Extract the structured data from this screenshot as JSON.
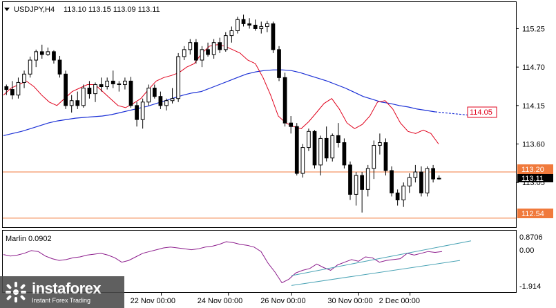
{
  "header": {
    "symbol": "USDJPY,H4",
    "ohlc": "113.10 113.15 113.09 113.11"
  },
  "indicator": {
    "label": "Marlin 0.0902",
    "ticks": [
      "0.8706",
      "0.00",
      "-1.914"
    ]
  },
  "price_labels": {
    "ma_value": "114.05",
    "level_high": "113.20",
    "level_low": "112.54",
    "last": "113.11"
  },
  "watermark": {
    "brand": "instaforex",
    "tagline": "Instant Forex Trading"
  },
  "colors": {
    "candle": "#000000",
    "ma_fast": "#e0001b",
    "ma_slow": "#1a2fd6",
    "level": "#f07a3c",
    "oscillator": "#8b1a8b",
    "channel": "#4aa3b5",
    "badge_border": "#e0001b"
  },
  "chart_data": [
    {
      "type": "candlestick",
      "title": "USDJPY,H4",
      "y_ticks": [
        115.25,
        114.7,
        114.15,
        113.6,
        113.05
      ],
      "x_ticks": [
        "22 Nov 00:00",
        "24 Nov 00:00",
        "26 Nov 00:00",
        "30 Nov 00:00",
        "2 Dec 00:00"
      ],
      "ylim": [
        112.42,
        115.62
      ],
      "levels": [
        113.2,
        112.54
      ],
      "candles": [
        [
          114.42,
          114.45,
          114.3,
          114.38
        ],
        [
          114.38,
          114.5,
          114.24,
          114.3
        ],
        [
          114.3,
          114.55,
          114.25,
          114.48
        ],
        [
          114.48,
          114.65,
          114.4,
          114.6
        ],
        [
          114.6,
          114.85,
          114.55,
          114.8
        ],
        [
          114.8,
          114.95,
          114.7,
          114.92
        ],
        [
          114.92,
          115.02,
          114.82,
          114.88
        ],
        [
          114.88,
          114.98,
          114.86,
          114.92
        ],
        [
          114.92,
          114.94,
          114.75,
          114.8
        ],
        [
          114.8,
          114.86,
          114.55,
          114.6
        ],
        [
          114.6,
          114.65,
          114.1,
          114.15
        ],
        [
          114.15,
          114.3,
          114.05,
          114.22
        ],
        [
          114.22,
          114.35,
          114.1,
          114.15
        ],
        [
          114.15,
          114.45,
          114.12,
          114.4
        ],
        [
          114.4,
          114.5,
          114.25,
          114.32
        ],
        [
          114.32,
          114.48,
          114.2,
          114.45
        ],
        [
          114.45,
          114.55,
          114.35,
          114.42
        ],
        [
          114.42,
          114.55,
          114.38,
          114.5
        ],
        [
          114.5,
          114.65,
          114.4,
          114.46
        ],
        [
          114.46,
          114.5,
          114.35,
          114.45
        ],
        [
          114.45,
          114.55,
          114.38,
          114.5
        ],
        [
          114.5,
          114.56,
          114.12,
          114.15
        ],
        [
          114.15,
          114.2,
          113.85,
          113.95
        ],
        [
          113.95,
          114.25,
          113.82,
          114.2
        ],
        [
          114.2,
          114.45,
          114.15,
          114.4
        ],
        [
          114.4,
          114.45,
          114.25,
          114.28
        ],
        [
          114.28,
          114.35,
          114.1,
          114.15
        ],
        [
          114.15,
          114.25,
          114.08,
          114.22
        ],
        [
          114.22,
          114.4,
          114.18,
          114.25
        ],
        [
          114.25,
          114.9,
          114.2,
          114.85
        ],
        [
          114.85,
          115.0,
          114.8,
          114.95
        ],
        [
          114.95,
          115.1,
          114.88,
          115.05
        ],
        [
          115.05,
          115.1,
          114.75,
          114.8
        ],
        [
          114.8,
          115.0,
          114.7,
          114.95
        ],
        [
          114.95,
          115.05,
          114.85,
          114.88
        ],
        [
          114.88,
          115.1,
          114.82,
          115.05
        ],
        [
          115.05,
          115.12,
          114.9,
          114.95
        ],
        [
          114.95,
          115.2,
          114.92,
          115.15
        ],
        [
          115.15,
          115.28,
          115.05,
          115.22
        ],
        [
          115.22,
          115.42,
          115.18,
          115.38
        ],
        [
          115.38,
          115.45,
          115.28,
          115.32
        ],
        [
          115.32,
          115.4,
          115.25,
          115.3
        ],
        [
          115.3,
          115.38,
          115.22,
          115.25
        ],
        [
          115.25,
          115.35,
          115.18,
          115.28
        ],
        [
          115.28,
          115.36,
          115.2,
          115.32
        ],
        [
          115.32,
          115.35,
          114.9,
          114.95
        ],
        [
          114.95,
          115.0,
          114.5,
          114.55
        ],
        [
          114.55,
          114.62,
          113.85,
          113.9
        ],
        [
          113.9,
          114.0,
          113.75,
          113.85
        ],
        [
          113.85,
          113.9,
          113.15,
          113.18
        ],
        [
          113.18,
          113.6,
          113.12,
          113.55
        ],
        [
          113.55,
          113.82,
          113.5,
          113.78
        ],
        [
          113.78,
          113.8,
          113.25,
          113.3
        ],
        [
          113.3,
          113.72,
          113.15,
          113.68
        ],
        [
          113.68,
          113.85,
          113.35,
          113.4
        ],
        [
          113.4,
          113.75,
          113.35,
          113.72
        ],
        [
          113.72,
          113.9,
          113.55,
          113.62
        ],
        [
          113.62,
          113.68,
          113.25,
          113.3
        ],
        [
          113.3,
          113.35,
          112.8,
          112.88
        ],
        [
          112.88,
          113.2,
          112.72,
          113.15
        ],
        [
          113.15,
          113.2,
          112.62,
          112.95
        ],
        [
          112.95,
          113.3,
          112.85,
          113.25
        ],
        [
          113.25,
          113.65,
          113.1,
          113.58
        ],
        [
          113.58,
          113.75,
          113.45,
          113.62
        ],
        [
          113.62,
          113.68,
          113.15,
          113.22
        ],
        [
          113.22,
          113.28,
          112.85,
          112.9
        ],
        [
          112.9,
          112.95,
          112.72,
          112.8
        ],
        [
          112.8,
          113.05,
          112.7,
          113.0
        ],
        [
          113.0,
          113.18,
          112.9,
          113.12
        ],
        [
          113.12,
          113.3,
          113.05,
          113.2
        ],
        [
          113.2,
          113.28,
          112.85,
          112.9
        ],
        [
          112.9,
          113.28,
          112.85,
          113.25
        ],
        [
          113.25,
          113.3,
          113.05,
          113.1
        ],
        [
          113.1,
          113.15,
          113.09,
          113.11
        ]
      ],
      "series": [
        {
          "name": "",
          "values": [
            113.72,
            113.75,
            113.78,
            113.82,
            113.86,
            113.9,
            113.93,
            113.95,
            113.97,
            113.98,
            113.99,
            114.0,
            114.02,
            114.05,
            114.08,
            114.11,
            114.14,
            114.18,
            114.22,
            114.26,
            114.3,
            114.33,
            114.35,
            114.4,
            114.45,
            114.5,
            114.55,
            114.6,
            114.63,
            114.65,
            114.66,
            114.66,
            114.65,
            114.62,
            114.58,
            114.54,
            114.5,
            114.45,
            114.4,
            114.34,
            114.28,
            114.24,
            114.2,
            114.18,
            114.15,
            114.13,
            114.1,
            114.08,
            114.06
          ]
        },
        {
          "name": "",
          "values": [
            114.3,
            114.4,
            114.45,
            114.5,
            114.42,
            114.3,
            114.2,
            114.15,
            114.25,
            114.35,
            114.4,
            114.45,
            114.45,
            114.35,
            114.25,
            114.15,
            114.12,
            114.18,
            114.25,
            114.38,
            114.5,
            114.55,
            114.58,
            114.62,
            114.7,
            114.75,
            114.9,
            115.0,
            115.02,
            115.0,
            114.95,
            114.9,
            114.8,
            114.75,
            114.55,
            114.3,
            114.0,
            113.9,
            113.85,
            113.82,
            113.92,
            114.05,
            114.18,
            114.25,
            114.1,
            113.9,
            113.82,
            113.88,
            114.0,
            114.2,
            114.22,
            114.1,
            113.9,
            113.78,
            113.75,
            113.8,
            113.75,
            113.6
          ]
        }
      ],
      "annotations": [
        "114.05",
        "113.20",
        "112.54",
        "113.11"
      ]
    },
    {
      "type": "line",
      "title": "Marlin 0.0902",
      "y_ticks": [
        0.8706,
        0.0,
        -1.914
      ],
      "ylim": [
        -1.914,
        0.8706
      ],
      "series": [
        {
          "name": "Marlin",
          "values": [
            -0.12,
            -0.2,
            -0.15,
            -0.05,
            0.1,
            0.05,
            -0.2,
            -0.35,
            -0.45,
            -0.4,
            -0.3,
            -0.25,
            -0.15,
            -0.1,
            -0.05,
            -0.15,
            -0.3,
            -0.55,
            -0.45,
            -0.25,
            -0.05,
            0.05,
            0.15,
            0.25,
            0.3,
            0.25,
            0.2,
            0.15,
            0.2,
            0.3,
            0.35,
            0.45,
            0.6,
            0.55,
            0.45,
            0.4,
            0.3,
            0.05,
            -0.6,
            -1.1,
            -1.7,
            -1.5,
            -1.15,
            -1.0,
            -0.9,
            -0.65,
            -0.85,
            -1.0,
            -0.7,
            -0.55,
            -0.4,
            -0.5,
            -0.25,
            -0.3,
            -0.55,
            -0.45,
            -0.4,
            -0.35,
            -0.05,
            -0.15,
            -0.05,
            0.05,
            0.0,
            0.05
          ]
        },
        {
          "name": "",
          "values": [
            -1.3,
            0.65
          ]
        },
        {
          "name": "",
          "values": [
            -1.85,
            -0.45
          ]
        }
      ]
    }
  ]
}
